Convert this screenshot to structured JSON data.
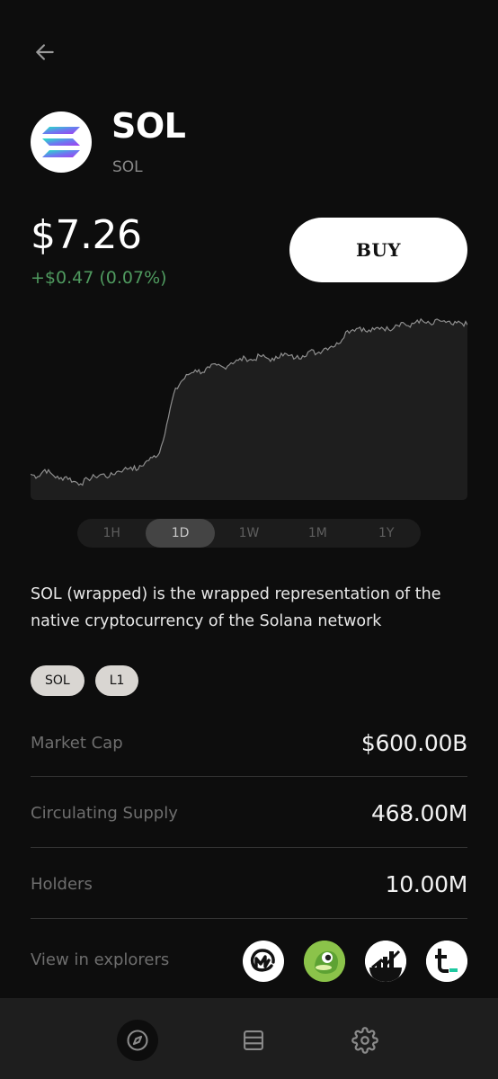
{
  "header": {
    "back_icon": "arrow-left-icon"
  },
  "token": {
    "name": "SOL",
    "symbol": "SOL",
    "logo_icon": "solana-logo",
    "price": "$7.26",
    "change": "+$0.47 (0.07%)",
    "change_color": "#4f9a5f"
  },
  "actions": {
    "buy_label": "BUY"
  },
  "chart_data": {
    "type": "area",
    "title": "",
    "series": [
      {
        "values": [
          2.1,
          2.0,
          2.3,
          2.1,
          1.9,
          2.0,
          1.8,
          1.7,
          1.9,
          2.0,
          2.1,
          2.0,
          2.2,
          2.3,
          2.4,
          2.3,
          2.6,
          2.8,
          3.0,
          4.2,
          5.5,
          6.0,
          6.3,
          6.5,
          6.4,
          6.6,
          6.7,
          6.6,
          6.8,
          6.9,
          7.0,
          6.9,
          7.1,
          7.0,
          6.9,
          7.2,
          7.1,
          7.0,
          7.1,
          7.3,
          7.2,
          7.4,
          7.5,
          7.6,
          8.1,
          8.2,
          8.3,
          8.1,
          8.2,
          8.3,
          8.2,
          8.4,
          8.5,
          8.3,
          8.6,
          8.5,
          8.4,
          8.6,
          8.5,
          8.4,
          8.5,
          8.4
        ]
      }
    ],
    "grid": false,
    "legend": "none",
    "line_color": "#8e8e8e",
    "fill_color": "#1e1e1e"
  },
  "range_tabs": [
    {
      "label": "1H",
      "active": false
    },
    {
      "label": "1D",
      "active": true
    },
    {
      "label": "1W",
      "active": false
    },
    {
      "label": "1M",
      "active": false
    },
    {
      "label": "1Y",
      "active": false
    }
  ],
  "description": "SOL (wrapped) is the wrapped representation of the native cryptocurrency of the Solana network",
  "tags": [
    "SOL",
    "L1"
  ],
  "stats": [
    {
      "label": "Market Cap",
      "value": "$600.00B"
    },
    {
      "label": "Circulating Supply",
      "value": "468.00M"
    },
    {
      "label": "Holders",
      "value": "10.00M"
    }
  ],
  "explorers": {
    "label": "View in explorers",
    "icons": [
      "coinmarketcap-icon",
      "coingecko-icon",
      "dexscreener-icon",
      "tonviewer-icon"
    ]
  },
  "bottom_nav": {
    "items": [
      {
        "icon": "compass-icon",
        "active": true
      },
      {
        "icon": "list-icon",
        "active": false
      },
      {
        "icon": "gear-icon",
        "active": false
      }
    ]
  }
}
